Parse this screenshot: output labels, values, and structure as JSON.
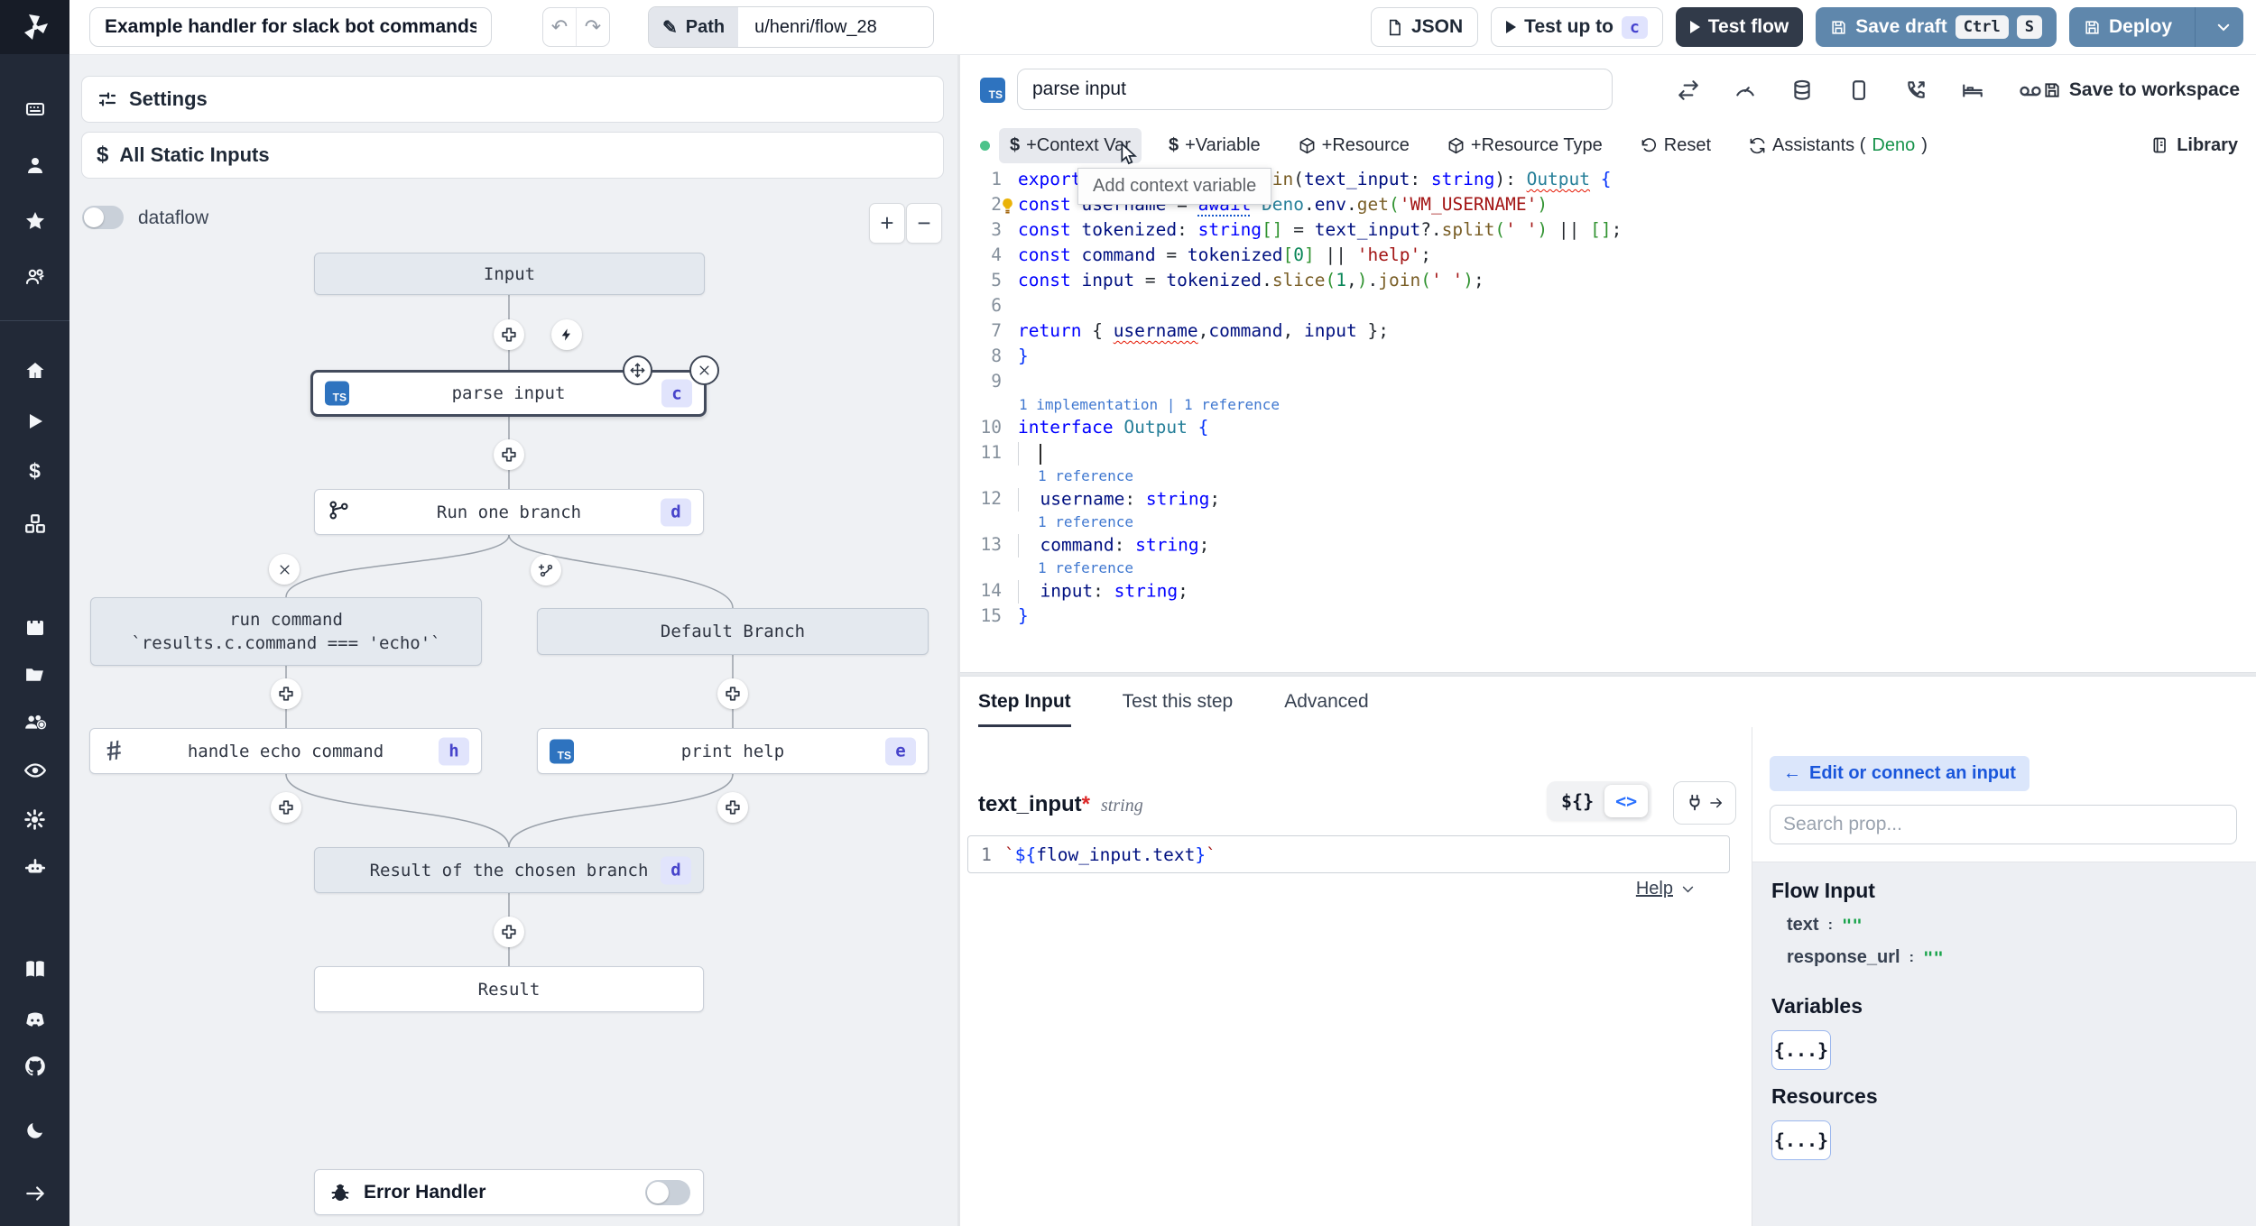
{
  "topbar": {
    "title": "Example handler for slack bot commands",
    "path_label": "Path",
    "path_value": "u/henri/flow_28",
    "json_label": "JSON",
    "test_up_to_label": "Test up to",
    "test_up_to_badge": "c",
    "test_flow_label": "Test flow",
    "save_draft_label": "Save draft",
    "kbd": [
      "Ctrl",
      "S"
    ],
    "deploy_label": "Deploy"
  },
  "icons": {
    "undo": "↶",
    "redo": "↷",
    "pencil": "✎",
    "dollar": "$",
    "hash": "#",
    "plus": "+",
    "minus": "−",
    "back_arrow": "←"
  },
  "flow": {
    "settings_label": "Settings",
    "static_inputs_label": "All Static Inputs",
    "dataflow_label": "dataflow",
    "lang_chip": "TS",
    "nodes": {
      "input": {
        "label": "Input"
      },
      "parse_input": {
        "label": "parse input",
        "badge": "c"
      },
      "run_one_branch": {
        "label": "Run one branch",
        "badge": "d"
      },
      "run_command": {
        "line1": "run command",
        "line2": "`results.c.command === 'echo'`"
      },
      "default_branch": {
        "label": "Default Branch"
      },
      "handle_echo": {
        "label": "handle echo command",
        "badge": "h"
      },
      "print_help": {
        "label": "print help",
        "badge": "e"
      },
      "result_chosen": {
        "label": "Result of the chosen branch",
        "badge": "d"
      },
      "result": {
        "label": "Result"
      },
      "error_handler": {
        "label": "Error Handler"
      }
    }
  },
  "editor": {
    "step_name": "parse input",
    "save_to_workspace": "Save to workspace",
    "toolbar": {
      "context_var": "+Context Var",
      "variable": "+Variable",
      "resource": "+Resource",
      "resource_type": "+Resource Type",
      "reset": "Reset",
      "assistants_prefix": "Assistants (",
      "assistants_lang": "Deno",
      "assistants_suffix": ")",
      "library": "Library"
    },
    "tooltip": "Add context variable",
    "code": {
      "rows": [
        {
          "n": "1",
          "t": [
            [
              "kw",
              "export async function "
            ],
            [
              "fn",
              "main"
            ],
            [
              "pl",
              "("
            ],
            [
              "id",
              "text_input"
            ],
            [
              "pl",
              ": "
            ],
            [
              "kw",
              "string"
            ],
            [
              "pl",
              "): "
            ],
            [
              "ty sq",
              "Output"
            ],
            [
              "pl",
              " "
            ],
            [
              "bb",
              "{"
            ]
          ]
        },
        {
          "n": "2",
          "bulb": true,
          "t": [
            [
              "pl",
              "  "
            ],
            [
              "kw",
              "const "
            ],
            [
              "id",
              "username"
            ],
            [
              "pl",
              " = "
            ],
            [
              "kw awt",
              "await"
            ],
            [
              "pl",
              " "
            ],
            [
              "ty",
              "Deno"
            ],
            [
              "pl",
              "."
            ],
            [
              "id",
              "env"
            ],
            [
              "pl",
              "."
            ],
            [
              "fn",
              "get"
            ],
            [
              "br",
              "("
            ],
            [
              "str",
              "'WM_USERNAME'"
            ],
            [
              "br",
              ")"
            ]
          ]
        },
        {
          "n": "3",
          "t": [
            [
              "pl",
              "  "
            ],
            [
              "kw",
              "const "
            ],
            [
              "id",
              "tokenized"
            ],
            [
              "pl",
              ": "
            ],
            [
              "kw",
              "string"
            ],
            [
              "br",
              "[]"
            ],
            [
              "pl",
              " = "
            ],
            [
              "id",
              "text_input"
            ],
            [
              "pl",
              "?."
            ],
            [
              "fn",
              "split"
            ],
            [
              "br",
              "("
            ],
            [
              "str",
              "' '"
            ],
            [
              "br",
              ")"
            ],
            [
              "pl",
              " || "
            ],
            [
              "br",
              "[]"
            ],
            [
              "pl",
              ";"
            ]
          ]
        },
        {
          "n": "4",
          "t": [
            [
              "pl",
              "  "
            ],
            [
              "kw",
              "const "
            ],
            [
              "id",
              "command"
            ],
            [
              "pl",
              " = "
            ],
            [
              "id",
              "tokenized"
            ],
            [
              "br",
              "["
            ],
            [
              "num",
              "0"
            ],
            [
              "br",
              "]"
            ],
            [
              "pl",
              " || "
            ],
            [
              "str",
              "'help'"
            ],
            [
              "pl",
              ";"
            ]
          ]
        },
        {
          "n": "5",
          "t": [
            [
              "pl",
              "  "
            ],
            [
              "kw",
              "const "
            ],
            [
              "id",
              "input"
            ],
            [
              "pl",
              " = "
            ],
            [
              "id",
              "tokenized"
            ],
            [
              "pl",
              "."
            ],
            [
              "fn",
              "slice"
            ],
            [
              "br",
              "("
            ],
            [
              "num",
              "1"
            ],
            [
              "pl",
              ","
            ],
            [
              "br",
              ")"
            ],
            [
              "pl",
              "."
            ],
            [
              "fn",
              "join"
            ],
            [
              "br",
              "("
            ],
            [
              "str",
              "' '"
            ],
            [
              "br",
              ")"
            ],
            [
              "pl",
              ";"
            ]
          ]
        },
        {
          "n": "6",
          "t": []
        },
        {
          "n": "7",
          "t": [
            [
              "pl",
              "  "
            ],
            [
              "kw",
              "return"
            ],
            [
              "pl",
              " { "
            ],
            [
              "id sq",
              "username"
            ],
            [
              "pl",
              ","
            ],
            [
              "id",
              "command"
            ],
            [
              "pl",
              ", "
            ],
            [
              "id",
              "input"
            ],
            [
              "pl",
              " };"
            ]
          ]
        },
        {
          "n": "8",
          "t": [
            [
              "bb",
              "}"
            ]
          ]
        },
        {
          "n": "9",
          "t": []
        },
        {
          "lens": "1 implementation | 1 reference"
        },
        {
          "n": "10",
          "t": [
            [
              "kw",
              "interface "
            ],
            [
              "ty",
              "Output"
            ],
            [
              "pl",
              " "
            ],
            [
              "bb",
              "{"
            ]
          ]
        },
        {
          "n": "11",
          "t": [
            [
              "guide",
              ""
            ],
            [
              "caret",
              ""
            ]
          ]
        },
        {
          "lens": "1 reference",
          "indent": true
        },
        {
          "n": "12",
          "t": [
            [
              "guide",
              ""
            ],
            [
              "id",
              "username"
            ],
            [
              "pl",
              ": "
            ],
            [
              "kw",
              "string"
            ],
            [
              "pl",
              ";"
            ]
          ]
        },
        {
          "lens": "1 reference",
          "indent": true
        },
        {
          "n": "13",
          "t": [
            [
              "guide",
              ""
            ],
            [
              "id",
              "command"
            ],
            [
              "pl",
              ": "
            ],
            [
              "kw",
              "string"
            ],
            [
              "pl",
              ";"
            ]
          ]
        },
        {
          "lens": "1 reference",
          "indent": true
        },
        {
          "n": "14",
          "t": [
            [
              "guide",
              ""
            ],
            [
              "id",
              "input"
            ],
            [
              "pl",
              ": "
            ],
            [
              "kw",
              "string"
            ],
            [
              "pl",
              ";"
            ]
          ]
        },
        {
          "n": "15",
          "t": [
            [
              "bb",
              "}"
            ]
          ]
        }
      ]
    }
  },
  "step_panel": {
    "tabs": [
      "Step Input",
      "Test this step",
      "Advanced"
    ],
    "field_name": "text_input",
    "field_required": "*",
    "field_type": "string",
    "toggle_template": "${}",
    "toggle_code": "<>",
    "expr_line_no": "1",
    "expr": [
      [
        "str",
        "`"
      ],
      [
        "bb",
        "${"
      ],
      [
        "id",
        "flow_input.text"
      ],
      [
        "bb",
        "}"
      ],
      [
        "str",
        "`"
      ]
    ],
    "help_label": "Help"
  },
  "right_panel": {
    "back_label": "Edit or connect an input",
    "search_placeholder": "Search prop...",
    "flow_input_title": "Flow Input",
    "props": [
      {
        "name": "text",
        "value": "\"\""
      },
      {
        "name": "response_url",
        "value": "\"\""
      }
    ],
    "variables_title": "Variables",
    "variables_value": "{...}",
    "resources_title": "Resources",
    "resources_value": "{...}"
  }
}
